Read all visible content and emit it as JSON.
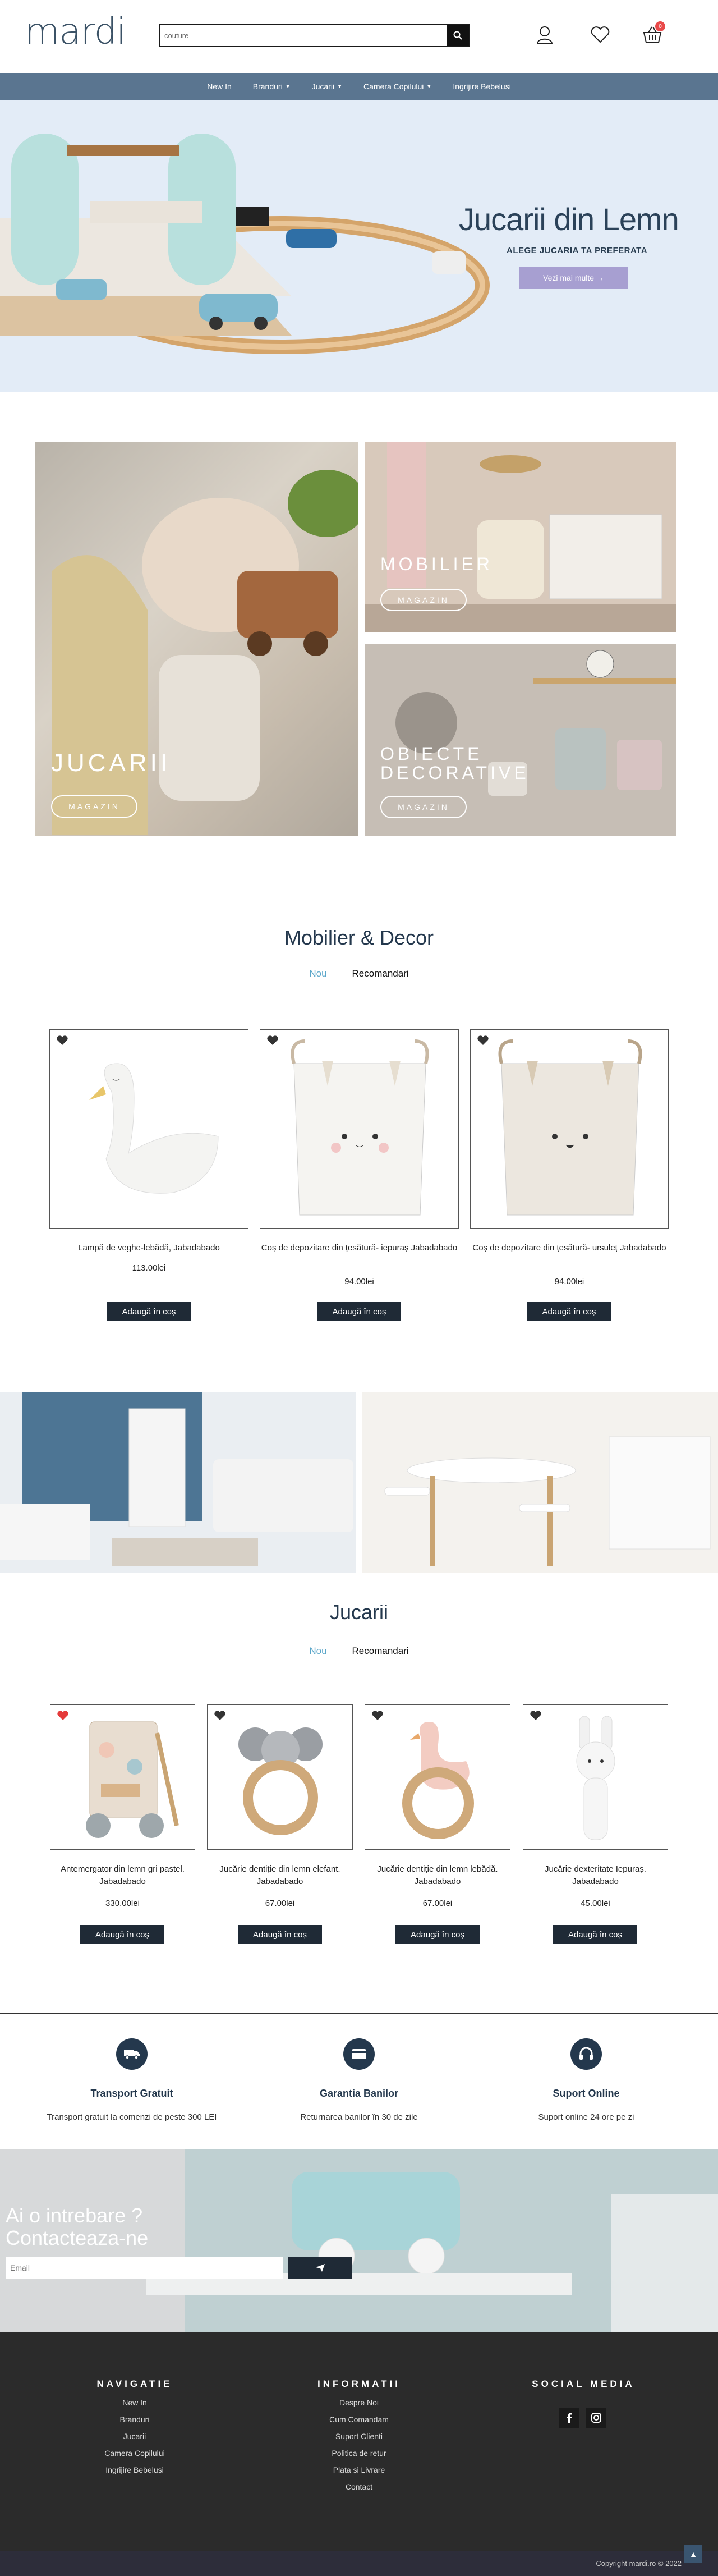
{
  "header": {
    "logo": "mardi",
    "search_value": "couture",
    "cart_count": "0"
  },
  "nav": {
    "items": [
      {
        "label": "New In"
      },
      {
        "label": "Branduri"
      },
      {
        "label": "Jucarii"
      },
      {
        "label": "Camera Copilului"
      },
      {
        "label": "Ingrijire Bebelusi"
      }
    ]
  },
  "hero": {
    "title": "Jucarii din Lemn",
    "subtitle": "ALEGE JUCARIA TA PREFERATA",
    "button": "Vezi mai multe →"
  },
  "categories": {
    "jucarii": {
      "label": "JUCARII",
      "button": "MAGAZIN"
    },
    "mobilier": {
      "label": "MOBILIER",
      "button": "MAGAZIN"
    },
    "obiecte": {
      "label": "OBIECTE DECORATIVE",
      "button": "MAGAZIN"
    }
  },
  "mobilier_section": {
    "title": "Mobilier & Decor",
    "tab_new": "Nou",
    "tab_rec": "Recomandari",
    "products": [
      {
        "name": "Lampă de veghe-lebădă, Jabadabado",
        "price": "113.00lei",
        "button": "Adaugă în coș"
      },
      {
        "name": "Coș de depozitare din țesătură- iepuraș Jabadabado",
        "price": "94.00lei",
        "button": "Adaugă în coș"
      },
      {
        "name": "Coș de depozitare din țesătură- ursuleț Jabadabado",
        "price": "94.00lei",
        "button": "Adaugă în coș"
      }
    ]
  },
  "jucarii_section": {
    "title": "Jucarii",
    "tab_new": "Nou",
    "tab_rec": "Recomandari",
    "products": [
      {
        "name": "Antemergator din lemn gri pastel. Jabadabado",
        "price": "330.00lei",
        "button": "Adaugă în coș"
      },
      {
        "name": "Jucărie dentiție din lemn elefant. Jabadabado",
        "price": "67.00lei",
        "button": "Adaugă în coș"
      },
      {
        "name": "Jucărie dentiție din lemn lebădă. Jabadabado",
        "price": "67.00lei",
        "button": "Adaugă în coș"
      },
      {
        "name": "Jucărie dexteritate Iepuraș. Jabadabado",
        "price": "45.00lei",
        "button": "Adaugă în coș"
      }
    ]
  },
  "features": [
    {
      "title": "Transport Gratuit",
      "text": "Transport gratuit la comenzi de peste 300 LEI"
    },
    {
      "title": "Garantia Banilor",
      "text": "Returnarea banilor în 30 de zile"
    },
    {
      "title": "Suport Online",
      "text": "Suport online 24 ore pe zi"
    }
  ],
  "contact": {
    "title_line1": "Ai o intrebare ?",
    "title_line2": "Contacteaza-ne",
    "email_placeholder": "Email"
  },
  "footer": {
    "nav_title": "NAVIGATIE",
    "nav_links": [
      "New In",
      "Branduri",
      "Jucarii",
      "Camera Copilului",
      "Ingrijire Bebelusi"
    ],
    "info_title": "INFORMATII",
    "info_links": [
      "Despre Noi",
      "Cum Comandam",
      "Suport Clienti",
      "Politica de retur",
      "Plata si Livrare",
      "Contact"
    ],
    "social_title": "SOCIAL MEDIA",
    "copyright": "Copyright mardi.ro © 2022"
  }
}
